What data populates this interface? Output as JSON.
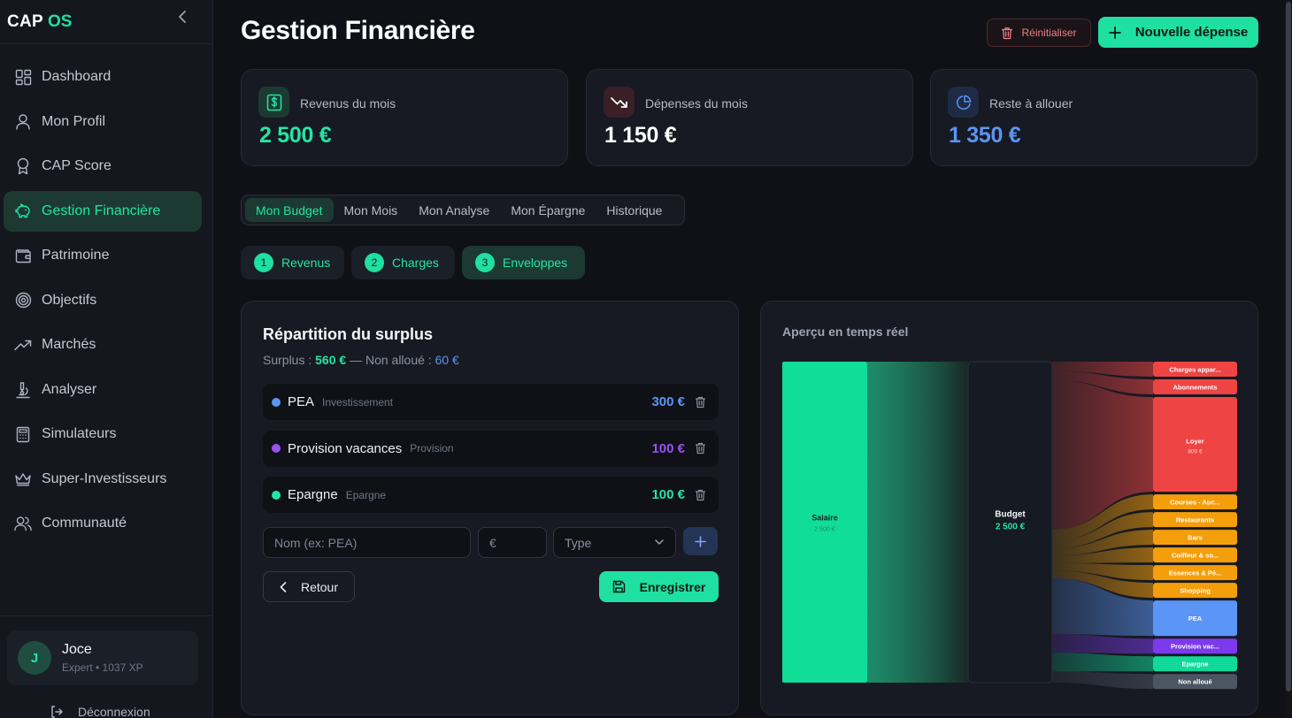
{
  "brand": {
    "cap": "CAP",
    "os": "OS"
  },
  "sidebar": {
    "items": [
      {
        "label": "Dashboard",
        "icon": "dashboard-icon"
      },
      {
        "label": "Mon Profil",
        "icon": "user-icon"
      },
      {
        "label": "CAP Score",
        "icon": "award-icon"
      },
      {
        "label": "Gestion Financière",
        "icon": "piggy-bank-icon"
      },
      {
        "label": "Patrimoine",
        "icon": "wallet-icon"
      },
      {
        "label": "Objectifs",
        "icon": "target-icon"
      },
      {
        "label": "Marchés",
        "icon": "trending-up-icon"
      },
      {
        "label": "Analyser",
        "icon": "microscope-icon"
      },
      {
        "label": "Simulateurs",
        "icon": "calculator-icon"
      },
      {
        "label": "Super-Investisseurs",
        "icon": "crown-icon"
      },
      {
        "label": "Communauté",
        "icon": "users-icon"
      }
    ],
    "active_index": 3
  },
  "user": {
    "initial": "J",
    "name": "Joce",
    "meta": "Expert • 1037 XP",
    "logout_label": "Déconnexion"
  },
  "header": {
    "title": "Gestion Financière",
    "reset_label": "Réinitialiser",
    "new_expense_label": "Nouvelle dépense"
  },
  "stats": [
    {
      "label": "Revenus du mois",
      "value": "2 500 €",
      "color": "#22e6a4",
      "icon": "dollar-icon"
    },
    {
      "label": "Dépenses du mois",
      "value": "1 150 €",
      "color": "#ffffff",
      "icon": "trending-down-icon"
    },
    {
      "label": "Reste à allouer",
      "value": "1 350 €",
      "color": "#5b95f5",
      "icon": "pie-chart-icon"
    }
  ],
  "tabs": [
    "Mon Budget",
    "Mon Mois",
    "Mon Analyse",
    "Mon Épargne",
    "Historique"
  ],
  "steps": [
    {
      "num": "1",
      "label": "Revenus"
    },
    {
      "num": "2",
      "label": "Charges"
    },
    {
      "num": "3",
      "label": "Enveloppes"
    }
  ],
  "surplus": {
    "title": "Répartition du surplus",
    "surplus_prefix": "Surplus :",
    "surplus_value": "560 €",
    "sep": "— Non alloué :",
    "unallocated_value": "60 €",
    "envelopes": [
      {
        "name": "PEA",
        "type": "Investissement",
        "amount": "300 €",
        "color": "#5b95f5"
      },
      {
        "name": "Provision vacances",
        "type": "Provision",
        "amount": "100 €",
        "color": "#9b51f0"
      },
      {
        "name": "Epargne",
        "type": "Epargne",
        "amount": "100 €",
        "color": "#22e6a4"
      }
    ],
    "name_placeholder": "Nom (ex: PEA)",
    "amount_placeholder": "€",
    "type_placeholder": "Type",
    "back_label": "Retour",
    "save_label": "Enregistrer"
  },
  "apercu": {
    "title": "Aperçu en temps réel",
    "source": {
      "label": "Salaire",
      "value": "2 500 €"
    },
    "budget": {
      "label": "Budget",
      "value": "2 500 €"
    },
    "targets": [
      {
        "label": "Charges appar...",
        "value": 50,
        "color": "#ef4444"
      },
      {
        "label": "Abonnements",
        "value": 50,
        "color": "#ef4444"
      },
      {
        "label": "Loyer",
        "sub": "800 €",
        "value": 800,
        "color": "#ef4444"
      },
      {
        "label": "Courses - Auc...",
        "value": 60,
        "color": "#f59e0b"
      },
      {
        "label": "Restaurants",
        "value": 40,
        "color": "#f59e0b"
      },
      {
        "label": "Bars",
        "value": 40,
        "color": "#f59e0b"
      },
      {
        "label": "Coiffeur & so...",
        "value": 40,
        "color": "#f59e0b"
      },
      {
        "label": "Essences & Pé...",
        "value": 40,
        "color": "#f59e0b"
      },
      {
        "label": "Shopping",
        "value": 40,
        "color": "#f59e0b"
      },
      {
        "label": "PEA",
        "value": 300,
        "color": "#5b95f5"
      },
      {
        "label": "Provision vac...",
        "value": 100,
        "color": "#7c3aed"
      },
      {
        "label": "Epargne",
        "value": 100,
        "color": "#10d99a"
      },
      {
        "label": "Non alloué",
        "value": 60,
        "color": "#4b5563"
      }
    ]
  }
}
